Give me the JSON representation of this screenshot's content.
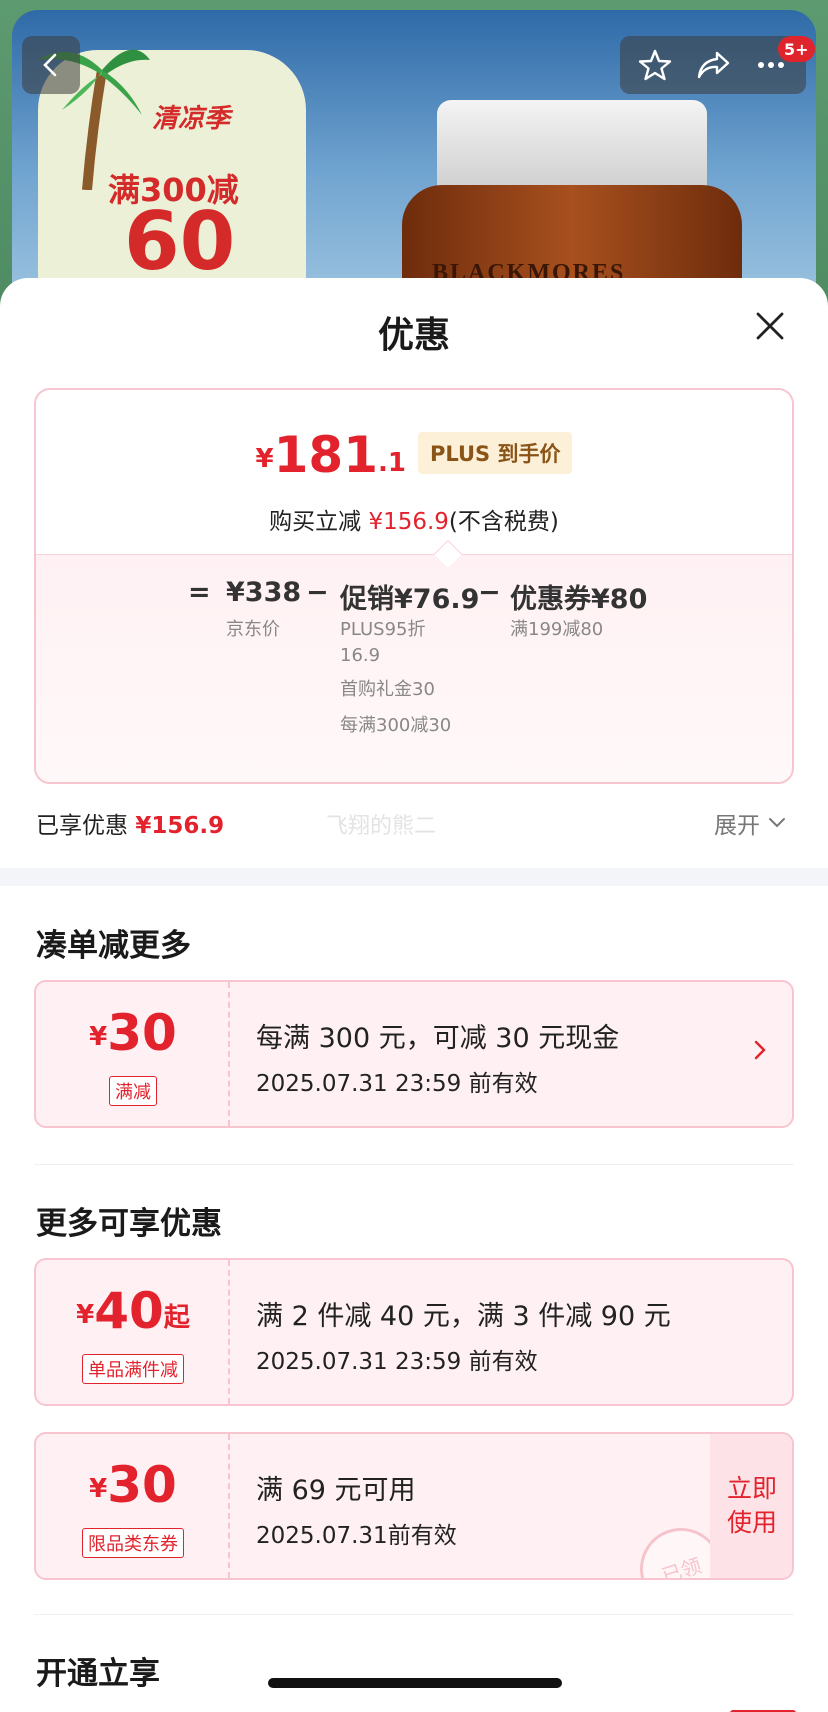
{
  "background": {
    "promo": {
      "logo": "清凉季",
      "line1": "满300减",
      "line2": "60"
    },
    "product_label": "BLACKMORES",
    "cart_badge": "5+"
  },
  "sheet": {
    "title": "优惠",
    "summary": {
      "price_yen": "¥",
      "price_int": "181",
      "price_dec": ".1",
      "plus_tag": "PLUS 到手价",
      "reduce_prefix": "购买立减",
      "reduce_amount": "¥156.9",
      "reduce_suffix": "(不含税费)",
      "equals": "=",
      "base_price": "¥338",
      "base_label": "京东价",
      "minus1": "−",
      "promo_price": "促销¥76.9",
      "promo_items": [
        "PLUS95折",
        "16.9",
        "首购礼金30",
        "每满300减30"
      ],
      "minus2": "−",
      "coupon_price": "优惠券¥80",
      "coupon_items": [
        "满199减80"
      ]
    },
    "enjoyed_label": "已享优惠",
    "enjoyed_amount": "¥156.9",
    "watermark": "飞翔的熊二",
    "expand_label": "展开",
    "section1_title": "凑单减更多",
    "section2_title": "更多可享优惠",
    "section3_title": "开通立享",
    "coupons": [
      {
        "yen": "¥",
        "amount": "30",
        "suffix": "",
        "tag": "满减",
        "desc": "每满 300 元，可减 30 元现金",
        "date": "2025.07.31 23:59 前有效"
      },
      {
        "yen": "¥",
        "amount": "40",
        "suffix": "起",
        "tag": "单品满件减",
        "desc": "满 2 件减 40 元，满 3 件减 90 元",
        "date": "2025.07.31 23:59 前有效"
      },
      {
        "yen": "¥",
        "amount": "30",
        "suffix": "",
        "tag": "限品类东券",
        "desc": "满 69 元可用",
        "date": "2025.07.31前有效",
        "action": "立即\n使用",
        "stamp": "已领"
      }
    ]
  },
  "colors": {
    "accent_red": "#e2232d",
    "plus_gold_bg": "#fdf0d9",
    "coupon_border": "#f6c5cf",
    "coupon_bg": "#fff1f3"
  },
  "icons": [
    "back-arrow-icon",
    "star-icon",
    "share-icon",
    "more-icon",
    "close-icon",
    "chevron-down-icon",
    "chevron-right-icon"
  ]
}
